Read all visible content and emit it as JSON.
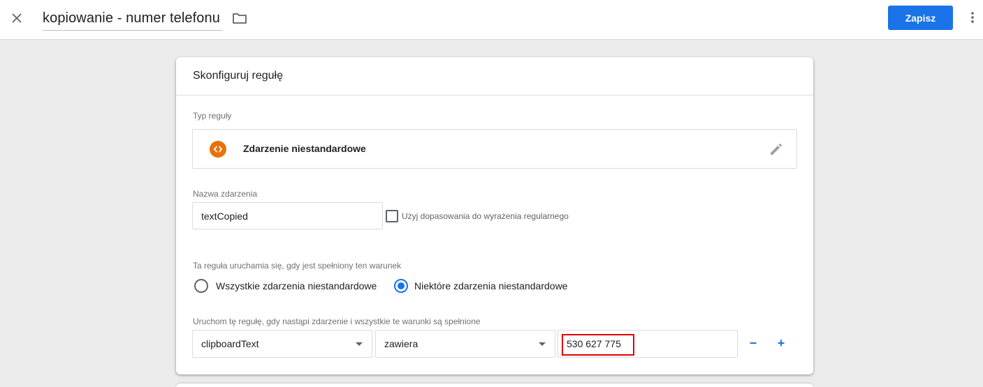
{
  "header": {
    "title": "kopiowanie - numer telefonu",
    "save_label": "Zapisz"
  },
  "card": {
    "title": "Skonfiguruj regułę",
    "rule_type": {
      "label": "Typ reguły",
      "name": "Zdarzenie niestandardowe",
      "icon": "code-brackets-icon",
      "icon_color": "#e8710a"
    },
    "event_name": {
      "label": "Nazwa zdarzenia",
      "value": "textCopied",
      "regex_checkbox_label": "Użyj dopasowania do wyrażenia regularnego",
      "regex_checked": false
    },
    "fires_on": {
      "label": "Ta reguła uruchamia się, gdy jest spełniony ten warunek",
      "options": [
        {
          "label": "Wszystkie zdarzenia niestandardowe",
          "selected": false
        },
        {
          "label": "Niektóre zdarzenia niestandardowe",
          "selected": true
        }
      ]
    },
    "condition": {
      "label": "Uruchom tę regułę, gdy nastąpi zdarzenie i wszystkie te warunki są spełnione",
      "variable": "clipboardText",
      "operator": "zawiera",
      "value": "530 627 775",
      "remove_label": "−",
      "add_label": "+"
    }
  },
  "colors": {
    "accent": "#1a73e8",
    "highlight": "#e30000"
  }
}
